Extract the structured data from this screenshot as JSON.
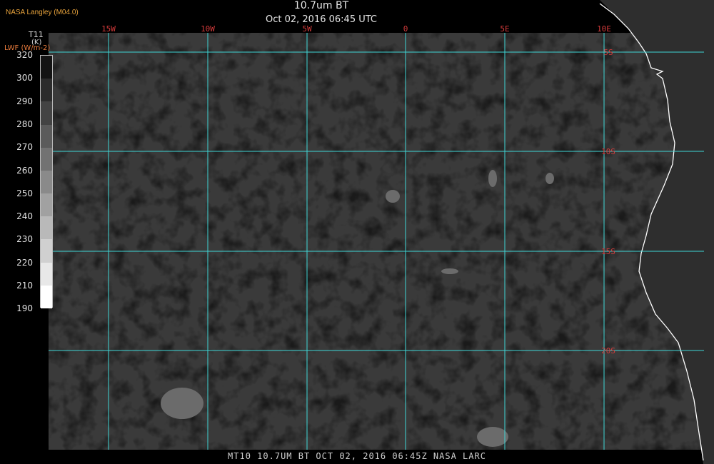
{
  "header": {
    "source": "NASA Langley (M04.0)",
    "title": "10.7um BT",
    "subtitle": "Oct 02, 2016 06:45 UTC"
  },
  "colorbar": {
    "title_line1": "T11",
    "title_line2": "(K)",
    "secondary_label": "LWF (W/m-2)",
    "ticks": [
      "320",
      "300",
      "290",
      "280",
      "270",
      "260",
      "250",
      "240",
      "230",
      "220",
      "210",
      "190"
    ],
    "max": 320,
    "min": 190
  },
  "map": {
    "longitude_labels": [
      "15W",
      "10W",
      "5W",
      "0",
      "5E",
      "10E"
    ],
    "latitude_labels": [
      "5S",
      "10S",
      "15S",
      "20S"
    ],
    "grid_color": "#3fd6d6",
    "lat_label_color": "#d23a3a",
    "lon_label_color": "#d23a3a",
    "coastline_color": "#ffffff",
    "ocean_color": "#3a3a3a",
    "land_color": "#2e2e2e"
  },
  "footer": {
    "text": "MT10  10.7UM BT   OCT 02, 2016 06:45Z   NASA LARC"
  }
}
